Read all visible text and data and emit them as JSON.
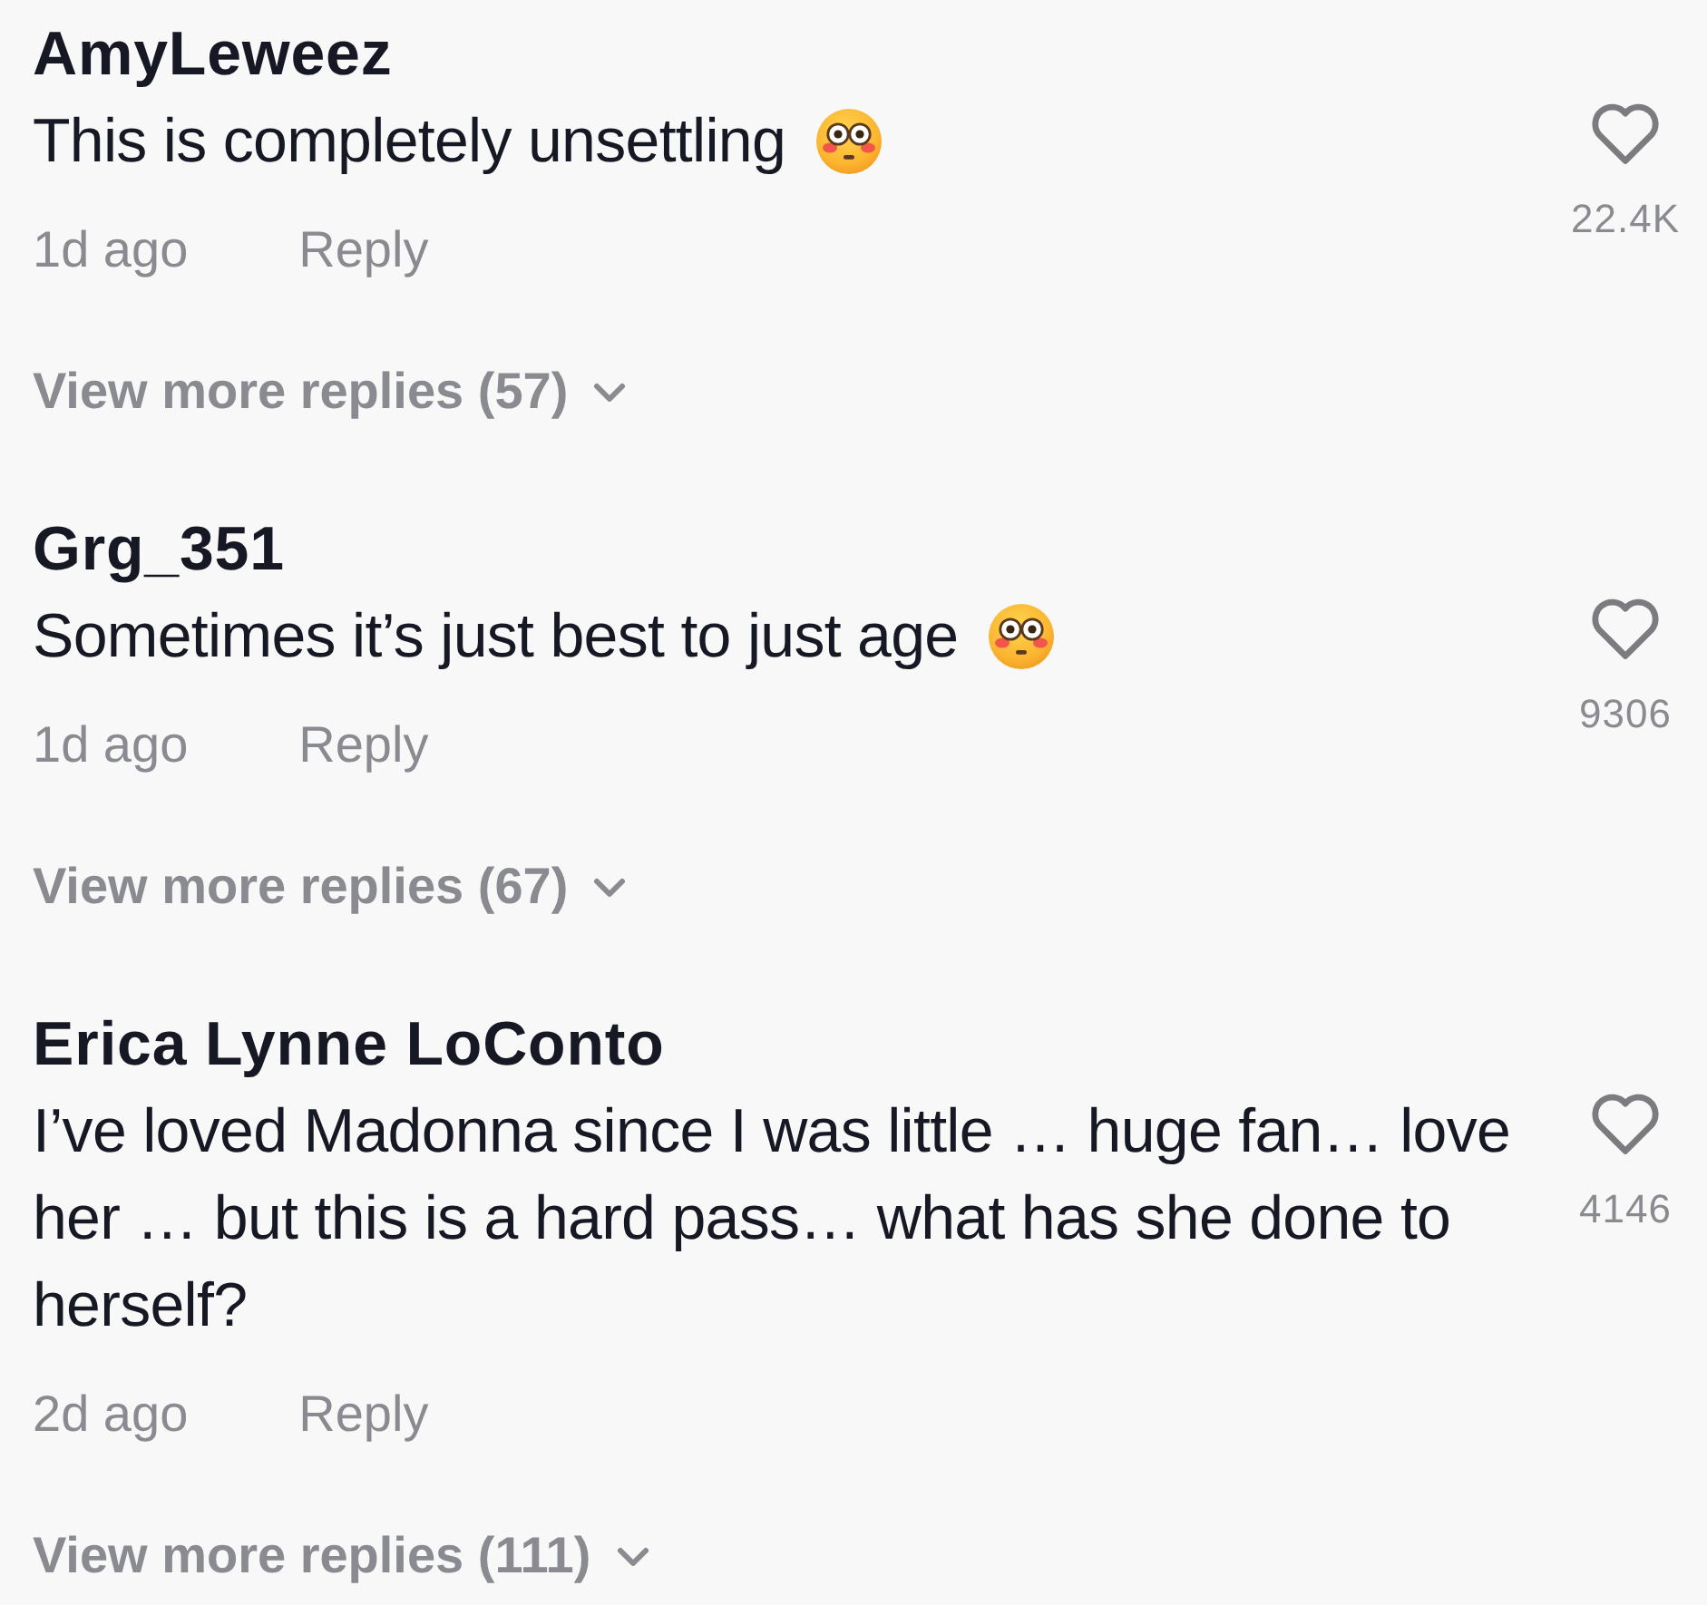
{
  "comments": [
    {
      "username": "AmyLeweez",
      "text": "This is completely unsettling",
      "emoji": true,
      "time": "1d ago",
      "reply_label": "Reply",
      "view_replies": "View more replies (57)",
      "liked": false,
      "like_count": "22.4K"
    },
    {
      "username": "Grg_351",
      "text": "Sometimes it’s just best to just age",
      "emoji": true,
      "time": "1d ago",
      "reply_label": "Reply",
      "view_replies": "View more replies (67)",
      "liked": false,
      "like_count": "9306"
    },
    {
      "username": "Erica Lynne LoConto",
      "text": "I’ve loved Madonna since I was little … huge fan… love her … but this is a hard pass… what has she done to herself?",
      "emoji": false,
      "time": "2d ago",
      "reply_label": "Reply",
      "view_replies": "View more replies (111)",
      "liked": false,
      "like_count": "4146"
    }
  ]
}
